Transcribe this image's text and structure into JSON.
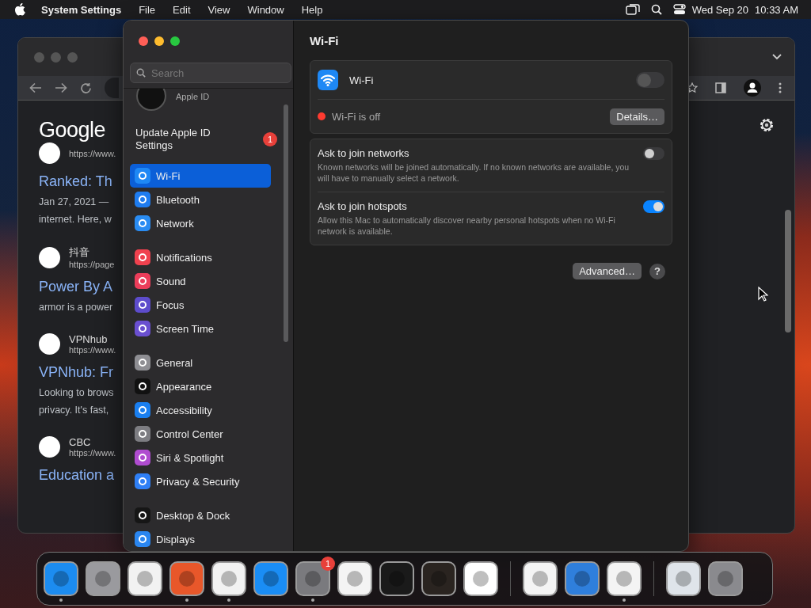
{
  "menu_bar": {
    "app": "System Settings",
    "menus": [
      "File",
      "Edit",
      "View",
      "Window",
      "Help"
    ],
    "date": "Wed Sep 20",
    "time": "10:33 AM"
  },
  "browser": {
    "logo": "Google",
    "results": [
      {
        "url": "https://www.",
        "title": "Ranked: Th",
        "snippet": [
          "Jan 27, 2021 —",
          "internet. Here, w"
        ]
      },
      {
        "site": "抖音",
        "url": "https://page",
        "title": "Power By A",
        "snippet": [
          "armor is a power"
        ]
      },
      {
        "site": "VPNhub",
        "url": "https://www.",
        "title": "VPNhub: Fr",
        "snippet": [
          "Looking to brows",
          "privacy. It's fast,"
        ]
      },
      {
        "site": "CBC",
        "url": "https://www.",
        "title": "Education a"
      }
    ]
  },
  "settings": {
    "search": {
      "placeholder": "Search"
    },
    "account": {
      "subtitle": "Apple ID"
    },
    "update": {
      "label": "Update Apple ID Settings",
      "badge": "1"
    },
    "groups": [
      {
        "items": [
          {
            "label": "Wi-Fi",
            "color": "#1e88f5",
            "selected": true
          },
          {
            "label": "Bluetooth",
            "color": "#1e7cf0",
            "selected": false
          },
          {
            "label": "Network",
            "color": "#2a8cf2",
            "selected": false
          }
        ]
      },
      {
        "items": [
          {
            "label": "Notifications",
            "color": "#f0414e",
            "selected": false
          },
          {
            "label": "Sound",
            "color": "#ec3d5a",
            "selected": false
          },
          {
            "label": "Focus",
            "color": "#5d4ccc",
            "selected": false
          },
          {
            "label": "Screen Time",
            "color": "#6a4fd0",
            "selected": false
          }
        ]
      },
      {
        "items": [
          {
            "label": "General",
            "color": "#8e8e93",
            "selected": false
          },
          {
            "label": "Appearance",
            "color": "#111111",
            "selected": false
          },
          {
            "label": "Accessibility",
            "color": "#1a7ff0",
            "selected": false
          },
          {
            "label": "Control Center",
            "color": "#7d7d82",
            "selected": false
          },
          {
            "label": "Siri & Spotlight",
            "color": "#b04cd0",
            "selected": false
          },
          {
            "label": "Privacy & Security",
            "color": "#2f7ff5",
            "selected": false
          }
        ]
      },
      {
        "items": [
          {
            "label": "Desktop & Dock",
            "color": "#161616",
            "selected": false
          },
          {
            "label": "Displays",
            "color": "#2a86f0",
            "selected": false
          }
        ]
      }
    ],
    "content": {
      "title": "Wi-Fi",
      "wifi": {
        "label": "Wi-Fi",
        "on": false,
        "status": "Wi-Fi is off",
        "details": "Details…"
      },
      "options": [
        {
          "title": "Ask to join networks",
          "description": "Known networks will be joined automatically. If no known networks are available, you will have to manually select a network.",
          "on": false
        },
        {
          "title": "Ask to join hotspots",
          "description": "Allow this Mac to automatically discover nearby personal hotspots when no Wi-Fi network is available.",
          "on": true
        }
      ],
      "advanced": "Advanced…",
      "help": "?"
    }
  },
  "dock": {
    "sections": [
      [
        {
          "color": "#1c8cf0",
          "running": true
        },
        {
          "color": "#9a9a9e",
          "running": false
        },
        {
          "color": "#f2f2f2",
          "running": false
        },
        {
          "color": "#e8572a",
          "running": true
        },
        {
          "color": "#f2f2f2",
          "running": true
        },
        {
          "color": "#1a8df5",
          "running": false
        },
        {
          "color": "#7a7a7e",
          "running": true,
          "badge": "1"
        },
        {
          "color": "#f4f4f4",
          "running": false
        },
        {
          "color": "#1a1a1a",
          "running": false
        },
        {
          "color": "#2a2420",
          "running": false
        },
        {
          "color": "#ffffff",
          "running": false
        }
      ],
      [
        {
          "color": "#f4f4f4",
          "running": false
        },
        {
          "color": "#2f7fdc",
          "running": false
        },
        {
          "color": "#f4f4f4",
          "running": true
        }
      ],
      [
        {
          "color": "#dfe4ea",
          "running": false
        },
        {
          "color": "#8a8a8e",
          "running": false
        }
      ]
    ]
  }
}
